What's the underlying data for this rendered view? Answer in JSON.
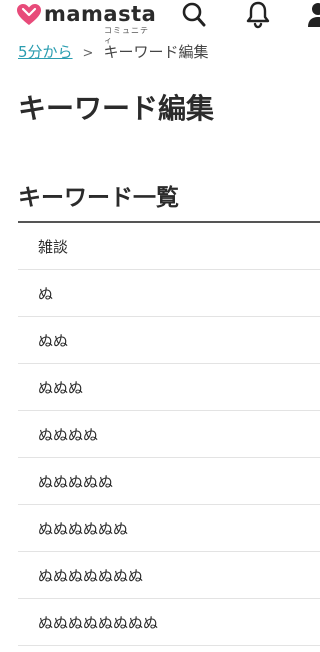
{
  "header": {
    "logo_text": "mamasta",
    "logo_sub": "コミュニティ",
    "icons": [
      "search-icon",
      "bell-icon",
      "user-icon"
    ]
  },
  "breadcrumb": {
    "link": "5分から",
    "separator": ">",
    "current": "キーワード編集"
  },
  "page_title": "キーワード編集",
  "section": {
    "title": "キーワード一覧",
    "items": [
      {
        "label": "雑談"
      },
      {
        "label": "ぬ"
      },
      {
        "label": "ぬぬ"
      },
      {
        "label": "ぬぬぬ"
      },
      {
        "label": "ぬぬぬぬ"
      },
      {
        "label": "ぬぬぬぬぬ"
      },
      {
        "label": "ぬぬぬぬぬぬ"
      },
      {
        "label": "ぬぬぬぬぬぬぬ"
      },
      {
        "label": "ぬぬぬぬぬぬぬぬ"
      }
    ]
  },
  "colors": {
    "brand_pink": "#e84b7a",
    "link": "#2a9db0",
    "text": "#2b2b2b"
  }
}
